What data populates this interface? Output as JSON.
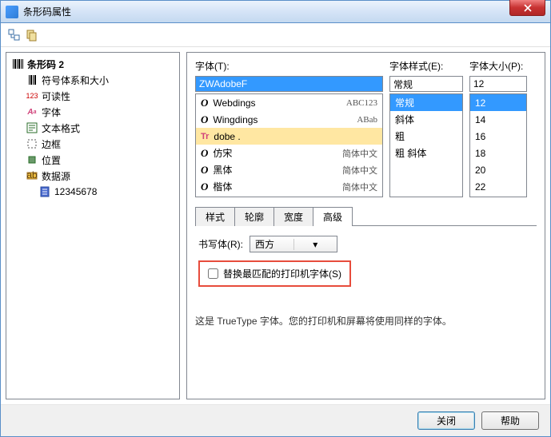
{
  "title": "条形码属性",
  "tree": {
    "root": "条形码 2",
    "items": [
      "符号体系和大小",
      "可读性",
      "字体",
      "文本格式",
      "边框",
      "位置",
      "数据源"
    ],
    "data_child": "12345678"
  },
  "font_section": {
    "font_label": "字体(T):",
    "font_value": "ZWAdobeF",
    "style_label": "字体样式(E):",
    "style_value": "常规",
    "size_label": "字体大小(P):",
    "size_value": "12",
    "font_list": [
      {
        "icon": "O",
        "name": "Webdings",
        "preview": "glyph1"
      },
      {
        "icon": "O",
        "name": "Wingdings",
        "preview": "glyph2"
      },
      {
        "icon": "T",
        "name": "dobe .",
        "preview": ""
      },
      {
        "icon": "O",
        "name": "仿宋",
        "preview": "简体中文"
      },
      {
        "icon": "O",
        "name": "黑体",
        "preview": "简体中文"
      },
      {
        "icon": "O",
        "name": "楷体",
        "preview": "简体中文"
      }
    ],
    "style_list": [
      "常规",
      "斜体",
      "粗",
      "粗 斜体"
    ],
    "size_list": [
      "12",
      "14",
      "16",
      "18",
      "20",
      "22"
    ]
  },
  "tabs": {
    "items": [
      "样式",
      "轮廓",
      "宽度",
      "高级"
    ],
    "active": 3
  },
  "advanced": {
    "script_label": "书写体(R):",
    "script_value": "西方",
    "substitute_label": "替换最匹配的打印机字体(S)"
  },
  "info": "这是 TrueType 字体。您的打印机和屏幕将使用同样的字体。",
  "buttons": {
    "close": "关闭",
    "help": "帮助"
  }
}
